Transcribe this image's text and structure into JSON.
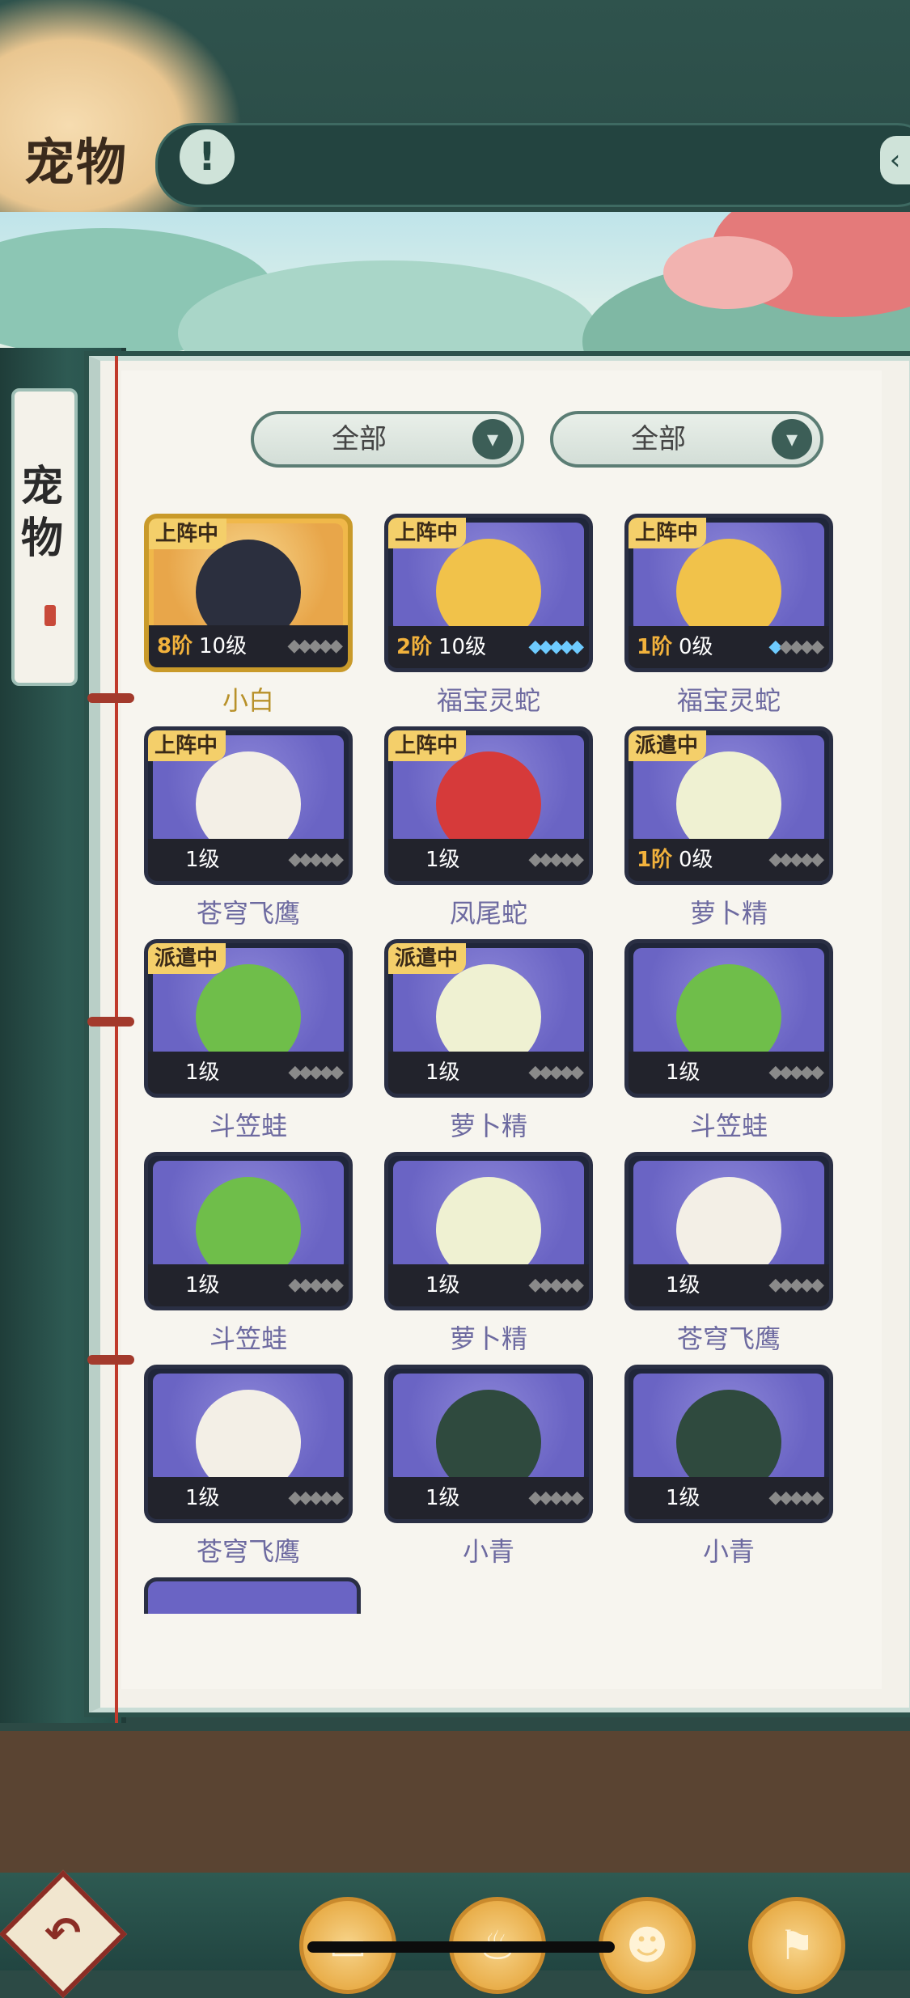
{
  "header": {
    "title": "宠物",
    "alert_glyph": "!",
    "collapse_glyph": "‹"
  },
  "side_tab": {
    "label": "宠物"
  },
  "filters": [
    {
      "label": "全部",
      "chevron": "▾"
    },
    {
      "label": "全部",
      "chevron": "▾"
    }
  ],
  "pets": [
    {
      "name": "小白",
      "status": "上阵中",
      "stage": "8阶",
      "level": "10级",
      "stars_lit": 0,
      "rarity": "gold",
      "color": "#2b2f3e"
    },
    {
      "name": "福宝灵蛇",
      "status": "上阵中",
      "stage": "2阶",
      "level": "10级",
      "stars_lit": 5,
      "rarity": "purple",
      "color": "#f1c24a"
    },
    {
      "name": "福宝灵蛇",
      "status": "上阵中",
      "stage": "1阶",
      "level": "0级",
      "stars_lit": 1,
      "rarity": "purple",
      "color": "#f1c24a"
    },
    {
      "name": "苍穹飞鹰",
      "status": "上阵中",
      "stage": "",
      "level": "1级",
      "stars_lit": 0,
      "rarity": "purple",
      "color": "#f3efe6"
    },
    {
      "name": "凤尾蛇",
      "status": "上阵中",
      "stage": "",
      "level": "1级",
      "stars_lit": 0,
      "rarity": "purple",
      "color": "#d63a3a"
    },
    {
      "name": "萝卜精",
      "status": "派遣中",
      "stage": "1阶",
      "level": "0级",
      "stars_lit": 0,
      "rarity": "purple",
      "color": "#eff1d2"
    },
    {
      "name": "斗笠蛙",
      "status": "派遣中",
      "stage": "",
      "level": "1级",
      "stars_lit": 0,
      "rarity": "purple",
      "color": "#6fbe4a"
    },
    {
      "name": "萝卜精",
      "status": "派遣中",
      "stage": "",
      "level": "1级",
      "stars_lit": 0,
      "rarity": "purple",
      "color": "#eff1d2"
    },
    {
      "name": "斗笠蛙",
      "status": "",
      "stage": "",
      "level": "1级",
      "stars_lit": 0,
      "rarity": "purple",
      "color": "#6fbe4a"
    },
    {
      "name": "斗笠蛙",
      "status": "",
      "stage": "",
      "level": "1级",
      "stars_lit": 0,
      "rarity": "purple",
      "color": "#6fbe4a"
    },
    {
      "name": "萝卜精",
      "status": "",
      "stage": "",
      "level": "1级",
      "stars_lit": 0,
      "rarity": "purple",
      "color": "#eff1d2"
    },
    {
      "name": "苍穹飞鹰",
      "status": "",
      "stage": "",
      "level": "1级",
      "stars_lit": 0,
      "rarity": "purple",
      "color": "#f3efe6"
    },
    {
      "name": "苍穹飞鹰",
      "status": "",
      "stage": "",
      "level": "1级",
      "stars_lit": 0,
      "rarity": "purple",
      "color": "#f3efe6"
    },
    {
      "name": "小青",
      "status": "",
      "stage": "",
      "level": "1级",
      "stars_lit": 0,
      "rarity": "purple",
      "color": "#2f4a3e"
    },
    {
      "name": "小青",
      "status": "",
      "stage": "",
      "level": "1级",
      "stars_lit": 0,
      "rarity": "purple",
      "color": "#2f4a3e"
    }
  ],
  "bottom_nav": {
    "back_glyph": "↶",
    "buttons": [
      "scroll-icon",
      "flame-icon",
      "cat-icon",
      "map-icon"
    ],
    "button_glyphs": [
      "▭",
      "♨",
      "☻",
      "⚑"
    ]
  }
}
